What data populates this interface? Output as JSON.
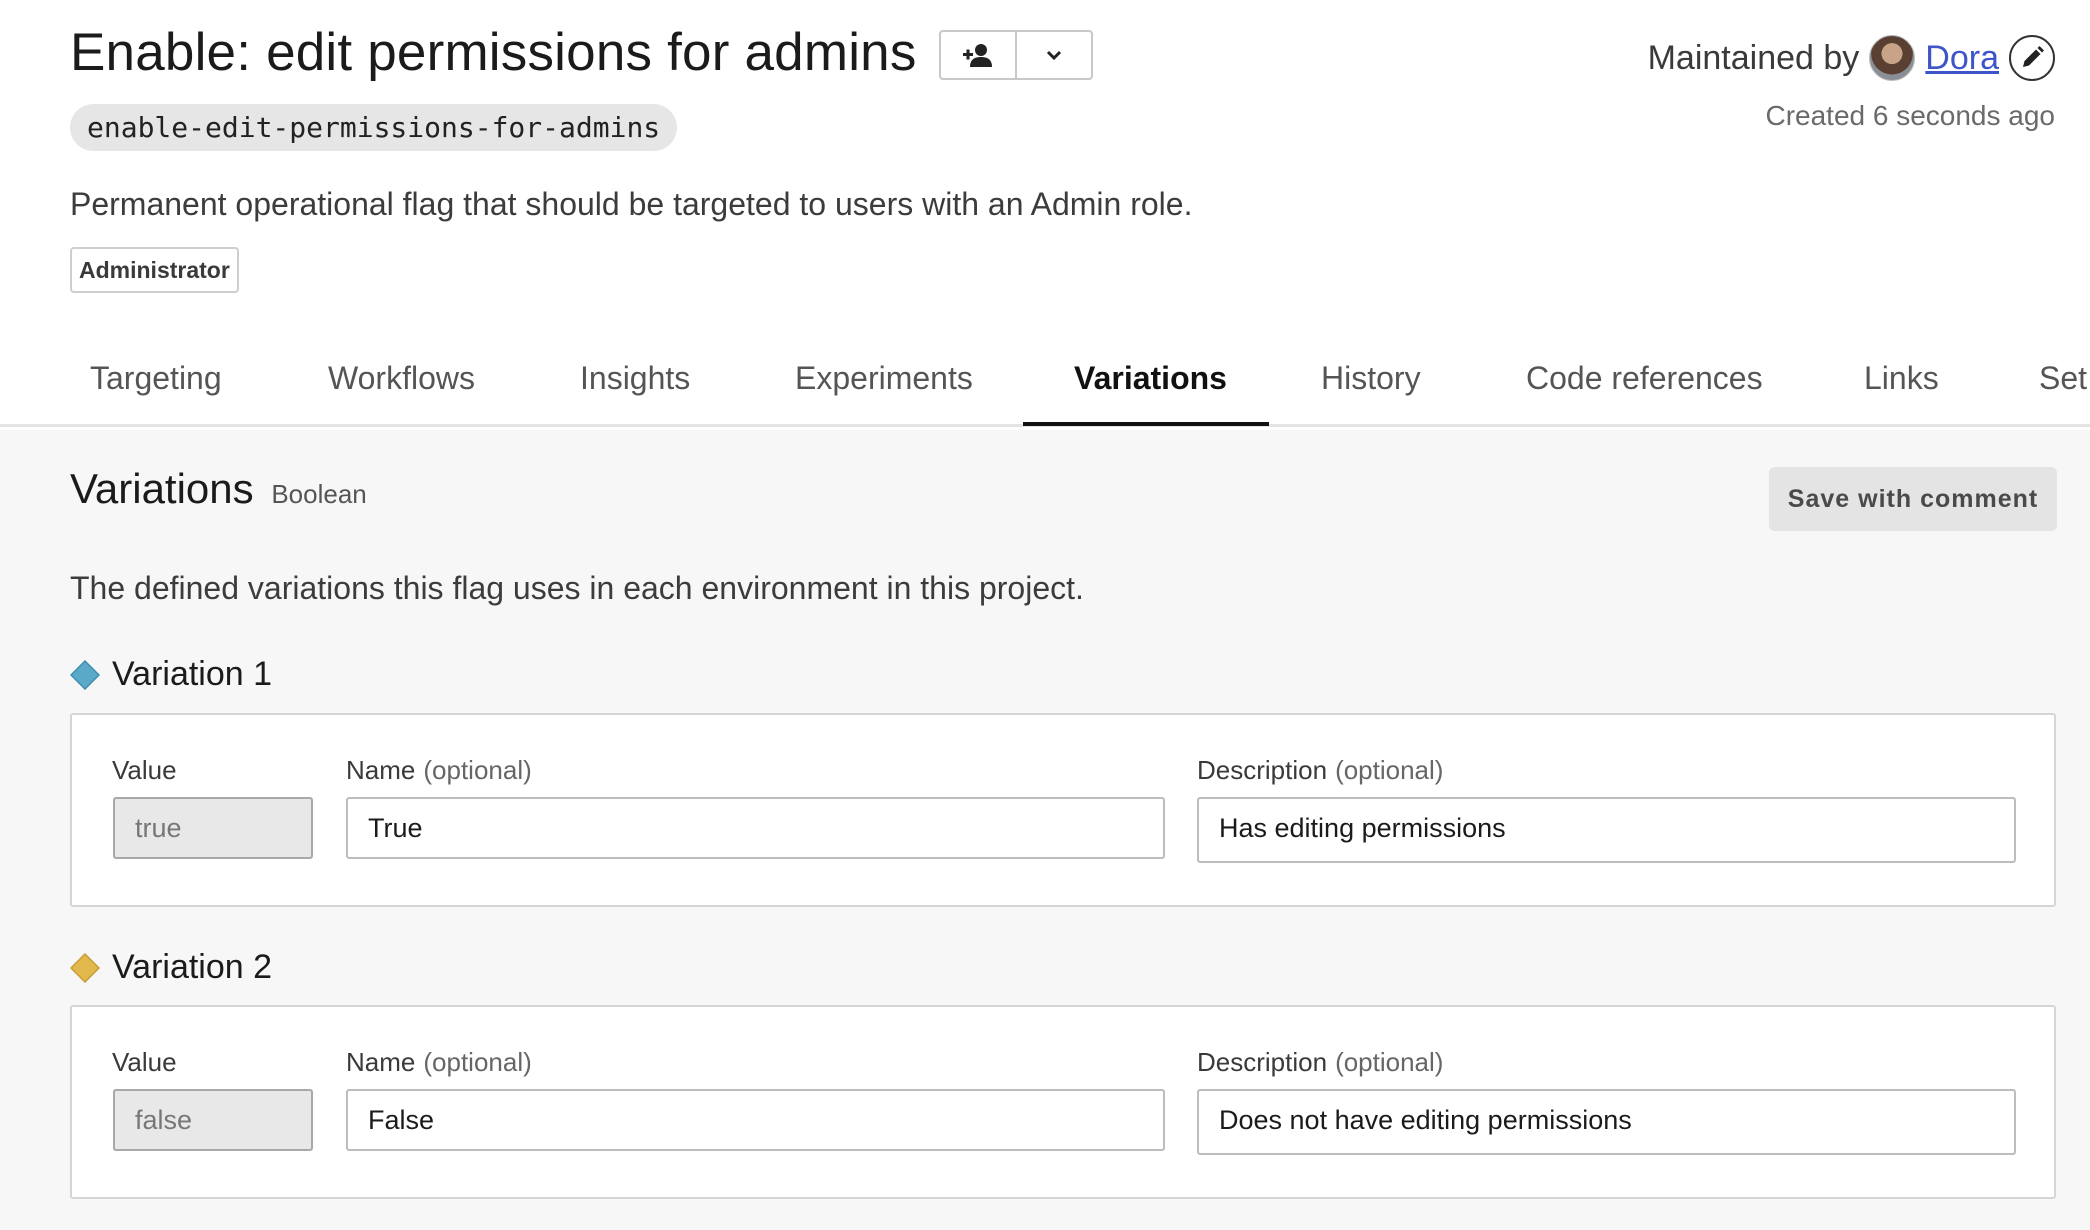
{
  "header": {
    "title": "Enable: edit permissions for admins",
    "flag_key": "enable-edit-permissions-for-admins",
    "maintainer_prefix": "Maintained by",
    "maintainer_name": "Dora",
    "created": "Created 6 seconds ago",
    "description": "Permanent operational flag that should be targeted to users with an Admin role.",
    "tag": "Administrator",
    "buttons": {
      "follow_icon": "person-plus-icon",
      "menu_icon": "chevron-down-icon"
    }
  },
  "tabs": [
    {
      "label": "Targeting"
    },
    {
      "label": "Workflows"
    },
    {
      "label": "Insights"
    },
    {
      "label": "Experiments"
    },
    {
      "label": "Variations",
      "active": true
    },
    {
      "label": "History"
    },
    {
      "label": "Code references"
    },
    {
      "label": "Links"
    },
    {
      "label": "Set"
    }
  ],
  "variations_section": {
    "title": "Variations",
    "type": "Boolean",
    "save_label": "Save with comment",
    "description": "The defined variations this flag uses in each environment in this project.",
    "labels": {
      "value": "Value",
      "name": "Name",
      "description": "Description",
      "optional": "(optional)"
    },
    "items": [
      {
        "heading": "Variation 1",
        "color": "#5aa9c8",
        "value": "true",
        "name": "True",
        "description": "Has editing permissions"
      },
      {
        "heading": "Variation 2",
        "color": "#e2b94c",
        "value": "false",
        "name": "False",
        "description": "Does not have editing permissions"
      }
    ]
  }
}
